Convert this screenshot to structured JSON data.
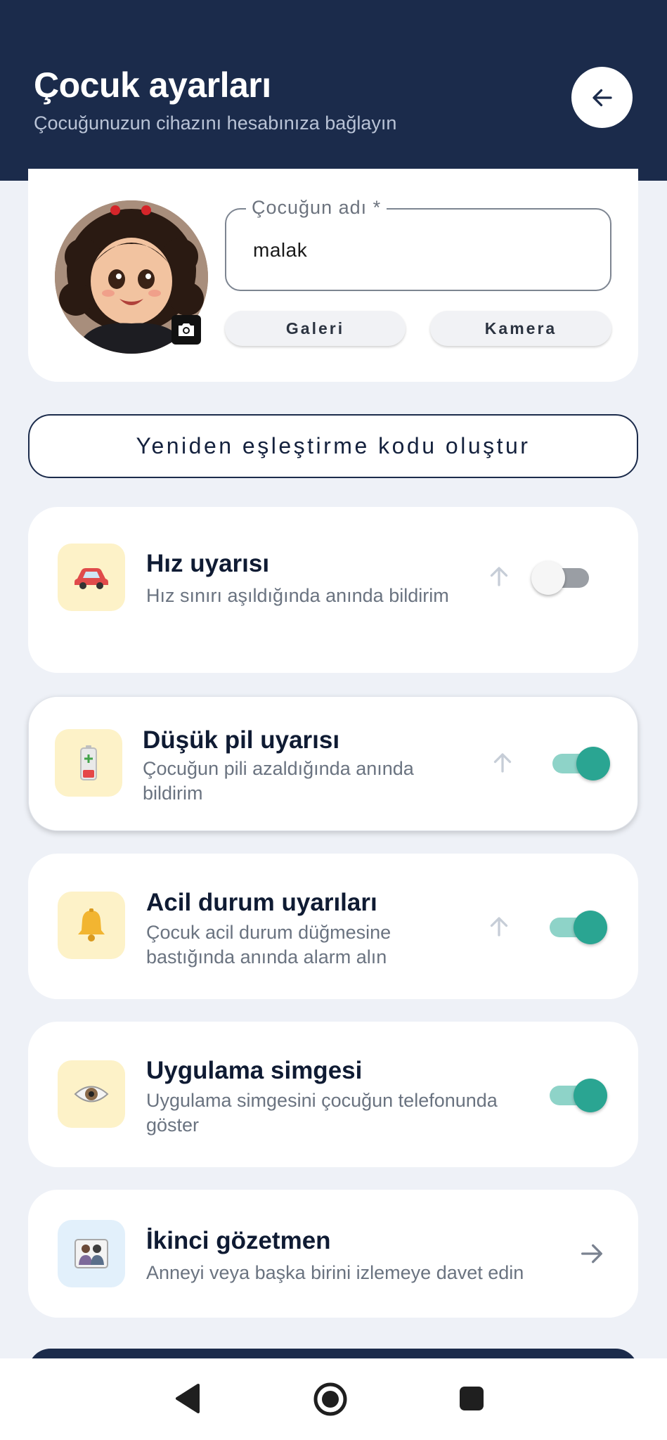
{
  "header": {
    "title": "Çocuk ayarları",
    "subtitle": "Çocuğunuzun cihazını hesabınıza bağlayın",
    "back_icon": "arrow-left-icon"
  },
  "profile": {
    "name_label": "Çocuğun adı *",
    "name_value": "malak",
    "gallery_label": "Galeri",
    "camera_label": "Kamera"
  },
  "regenerate_label": "Yeniden eşleştirme kodu oluştur",
  "settings": [
    {
      "title": "Hız uyarısı",
      "desc_lines": [
        "Hız sınırı aşıldığında anında bildirim"
      ],
      "icon": "car-icon",
      "enabled": false
    },
    {
      "title": "Düşük pil uyarısı",
      "desc_lines": [
        "Çocuğun pili azaldığında anında",
        "bildirim"
      ],
      "icon": "battery-icon",
      "enabled": true
    },
    {
      "title": "Acil durum uyarıları",
      "desc_lines": [
        "Çocuk acil durum düğmesine",
        "bastığında anında alarm alın"
      ],
      "icon": "bell-icon",
      "enabled": true
    },
    {
      "title": "Uygulama simgesi",
      "desc_lines": [
        "Uygulama simgesini çocuğun telefonunda",
        "göster"
      ],
      "icon": "eye-icon",
      "enabled": true
    }
  ],
  "second_guardian": {
    "title": "İkinci gözetmen",
    "desc": "Anneyi veya başka birini izlemeye davet edin",
    "icon": "family-icon"
  },
  "colors": {
    "header_bg": "#1b2b4b",
    "accent_teal": "#2aa592",
    "page_bg": "#eef1f7"
  }
}
